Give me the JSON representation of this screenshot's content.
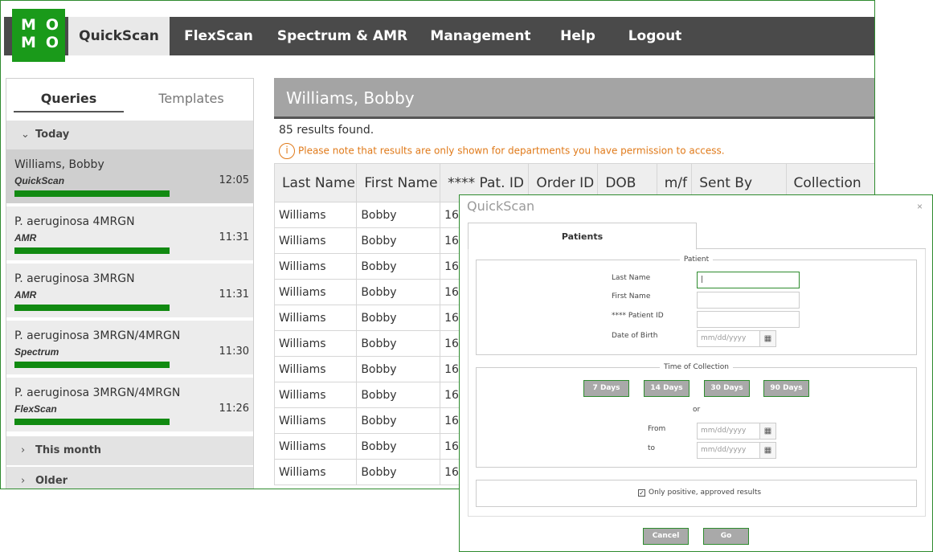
{
  "brand": {
    "logo_line1": "MO",
    "logo_line2": "MO",
    "accent": "#1a9a1a"
  },
  "nav": {
    "items": [
      "QuickScan",
      "FlexScan",
      "Spectrum & AMR",
      "Management",
      "Help",
      "Logout"
    ],
    "active": "QuickScan"
  },
  "sidebar": {
    "tabs": [
      "Queries",
      "Templates"
    ],
    "today_label": "Today",
    "this_month_label": "This month",
    "older_label": "Older",
    "queries": [
      {
        "name": "Williams, Bobby",
        "type": "QuickScan",
        "time": "12:05",
        "progress": 1.0
      },
      {
        "name": "P. aeruginosa 4MRGN",
        "type": "AMR",
        "time": "11:31",
        "progress": 1.0
      },
      {
        "name": "P. aeruginosa 3MRGN",
        "type": "AMR",
        "time": "11:31",
        "progress": 1.0
      },
      {
        "name": "P. aeruginosa 3MRGN/4MRGN",
        "type": "Spectrum",
        "time": "11:30",
        "progress": 1.0
      },
      {
        "name": "P. aeruginosa 3MRGN/4MRGN",
        "type": "FlexScan",
        "time": "11:26",
        "progress": 1.0
      }
    ]
  },
  "results": {
    "title": "Williams, Bobby",
    "count": "85 results found.",
    "notice": "Please note that results are only shown for departments you have permission to access.",
    "columns": [
      "Last Name",
      "First Name",
      "**** Pat. ID",
      "Order ID",
      "DOB",
      "m/f",
      "Sent By",
      "Collection"
    ],
    "rows": [
      [
        "Williams",
        "Bobby",
        "16"
      ],
      [
        "Williams",
        "Bobby",
        "16"
      ],
      [
        "Williams",
        "Bobby",
        "16"
      ],
      [
        "Williams",
        "Bobby",
        "16"
      ],
      [
        "Williams",
        "Bobby",
        "16"
      ],
      [
        "Williams",
        "Bobby",
        "16"
      ],
      [
        "Williams",
        "Bobby",
        "16"
      ],
      [
        "Williams",
        "Bobby",
        "16"
      ],
      [
        "Williams",
        "Bobby",
        "16"
      ],
      [
        "Williams",
        "Bobby",
        "16"
      ],
      [
        "Williams",
        "Bobby",
        "16"
      ]
    ]
  },
  "modal": {
    "title": "QuickScan",
    "close": "×",
    "tab": "Patients",
    "patient_legend": "Patient",
    "last_name_label": "Last Name",
    "first_name_label": "First Name",
    "patient_id_label": "**** Patient ID",
    "dob_label": "Date of Birth",
    "date_placeholder": "mm/dd/yyyy",
    "last_name_value": "|",
    "time_legend": "Time of Collection",
    "day_buttons": [
      "7 Days",
      "14 Days",
      "30 Days",
      "90 Days"
    ],
    "or_label": "or",
    "from_label": "From",
    "to_label": "to",
    "positive_label": "Only positive, approved results",
    "positive_checked": true,
    "check_mark": "✓",
    "calendar_icon": "▦",
    "cancel_label": "Cancel",
    "go_label": "Go"
  }
}
